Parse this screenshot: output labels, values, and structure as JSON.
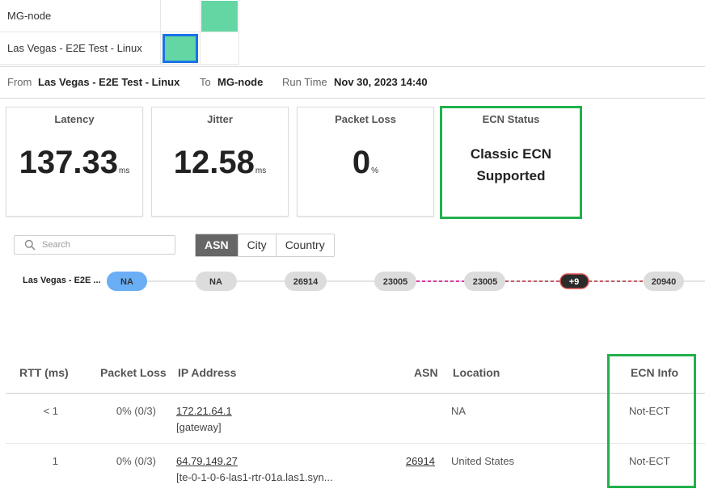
{
  "matrix": {
    "rows": [
      "MG-node",
      "Las Vegas - E2E Test - Linux"
    ]
  },
  "run_info": {
    "from_label": "From",
    "from_value": "Las Vegas - E2E Test - Linux",
    "to_label": "To",
    "to_value": "MG-node",
    "time_label": "Run Time",
    "time_value": "Nov 30, 2023 14:40"
  },
  "metrics": {
    "latency": {
      "title": "Latency",
      "value": "137.33",
      "unit": "ms"
    },
    "jitter": {
      "title": "Jitter",
      "value": "12.58",
      "unit": "ms"
    },
    "packet_loss": {
      "title": "Packet Loss",
      "value": "0",
      "unit": "%"
    },
    "ecn": {
      "title": "ECN Status",
      "line1": "Classic ECN",
      "line2": "Supported"
    }
  },
  "search": {
    "placeholder": "Search",
    "icon": "search-icon"
  },
  "view_toggle": {
    "asn": "ASN",
    "city": "City",
    "country": "Country",
    "selected": "ASN"
  },
  "path": {
    "source_label": "Las Vegas - E2E ...",
    "hops": [
      "NA",
      "NA",
      "26914",
      "23005",
      "23005",
      "+9",
      "20940"
    ],
    "colors": {
      "source_hop": "#6aaef5",
      "hop": "#dcdcdc",
      "collapsed": "#2b2b2b",
      "collapsed_border": "#d9534f",
      "link_magenta": "#d4259b",
      "link_red": "#b5323f"
    }
  },
  "table": {
    "headers": {
      "rtt": "RTT (ms)",
      "loss": "Packet Loss",
      "ip": "IP Address",
      "asn": "ASN",
      "location": "Location",
      "ecn": "ECN Info"
    },
    "rows": [
      {
        "rtt": "< 1",
        "loss": "0% (0/3)",
        "ip": "172.21.64.1",
        "ip_sub": "[gateway]",
        "asn": "",
        "location": "NA",
        "ecn": "Not-ECT"
      },
      {
        "rtt": "1",
        "loss": "0% (0/3)",
        "ip": "64.79.149.27",
        "ip_sub": "[te-0-1-0-6-las1-rtr-01a.las1.syn...",
        "asn": "26914",
        "location": "United States",
        "ecn": "Not-ECT"
      }
    ]
  },
  "colors": {
    "highlight": "#22b14c",
    "matrix_cell": "#63d6a3",
    "selected_cell_border": "#1a73e8"
  }
}
